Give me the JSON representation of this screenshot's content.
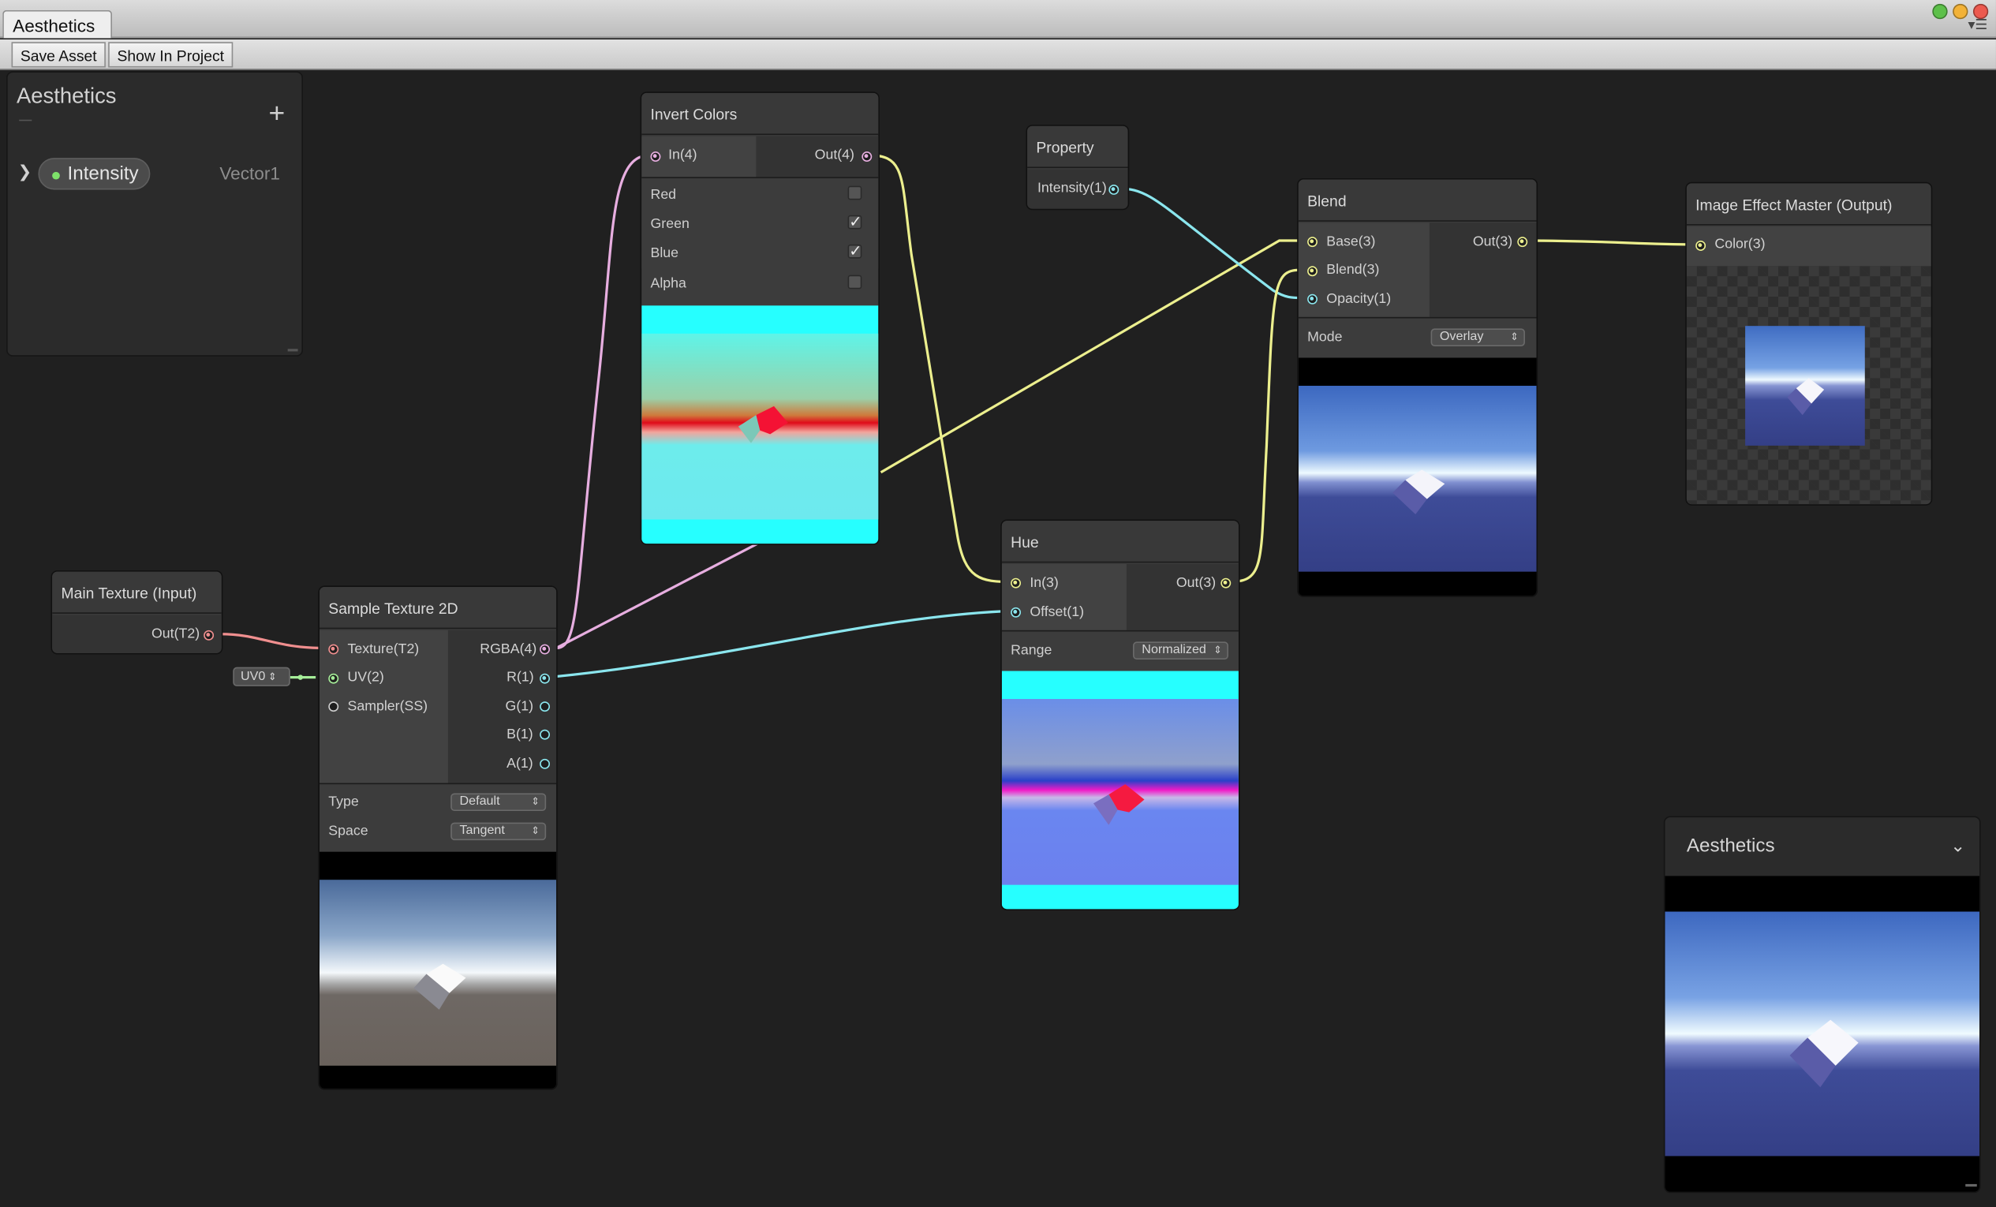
{
  "window": {
    "tab_title": "Aesthetics",
    "menu_icon": "tab-menu-icon"
  },
  "toolbar": {
    "save_asset": "Save Asset",
    "show_in_project": "Show In Project"
  },
  "blackboard": {
    "title": "Aesthetics",
    "add_icon": "+",
    "properties": [
      {
        "name": "Intensity",
        "type": "Vector1"
      }
    ]
  },
  "nodes": {
    "invert_colors": {
      "title": "Invert Colors",
      "input": "In(4)",
      "output": "Out(4)",
      "toggles": [
        {
          "label": "Red",
          "checked": false
        },
        {
          "label": "Green",
          "checked": true
        },
        {
          "label": "Blue",
          "checked": true
        },
        {
          "label": "Alpha",
          "checked": false
        }
      ]
    },
    "property": {
      "title": "Property",
      "output": "Intensity(1)"
    },
    "blend": {
      "title": "Blend",
      "inputs": [
        "Base(3)",
        "Blend(3)",
        "Opacity(1)"
      ],
      "output": "Out(3)",
      "mode_label": "Mode",
      "mode_value": "Overlay"
    },
    "master": {
      "title": "Image Effect Master (Output)",
      "input": "Color(3)"
    },
    "main_texture": {
      "title": "Main Texture (Input)",
      "output": "Out(T2)"
    },
    "sample_texture": {
      "title": "Sample Texture 2D",
      "inputs": [
        "Texture(T2)",
        "UV(2)",
        "Sampler(SS)"
      ],
      "outputs": [
        "RGBA(4)",
        "R(1)",
        "G(1)",
        "B(1)",
        "A(1)"
      ],
      "type_label": "Type",
      "type_value": "Default",
      "space_label": "Space",
      "space_value": "Tangent",
      "uv_value": "UV0"
    },
    "hue": {
      "title": "Hue",
      "inputs": [
        "In(3)",
        "Offset(1)"
      ],
      "output": "Out(3)",
      "range_label": "Range",
      "range_value": "Normalized"
    }
  },
  "main_preview": {
    "title": "Aesthetics"
  },
  "colors": {
    "background": "#202020",
    "vector4": "#e7aee0",
    "vector3": "#ecef8e",
    "vector1": "#8be6ee",
    "texture": "#f08f8f",
    "vector2": "#a6ee99"
  }
}
